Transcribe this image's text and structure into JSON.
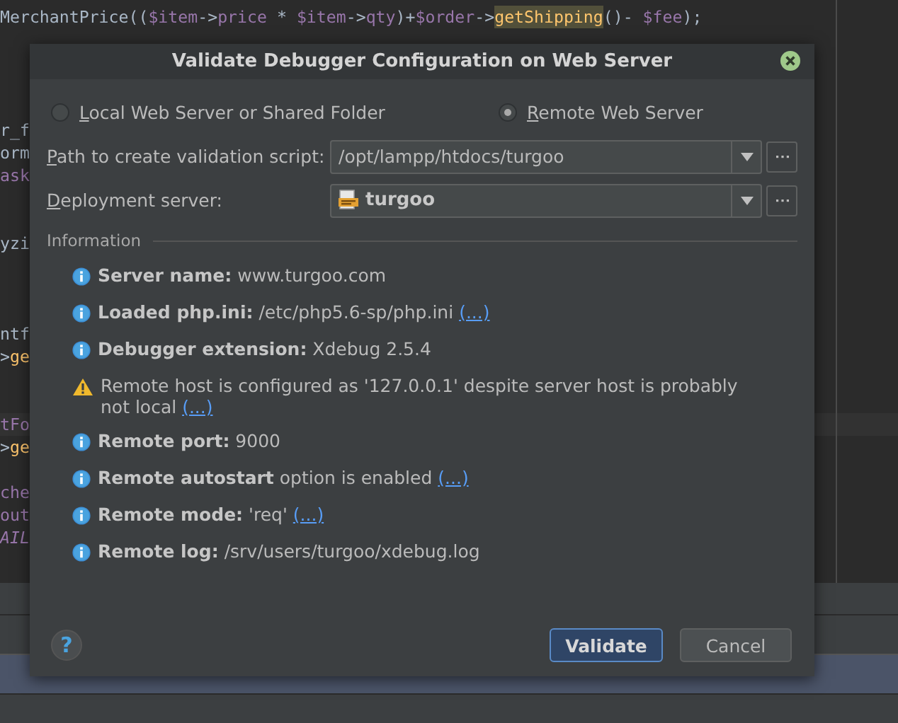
{
  "editor": {
    "lines": [
      {
        "kind": "code",
        "segments": [
          {
            "kind": "plain",
            "text": "MerchantPrice(("
          },
          {
            "kind": "var",
            "text": "$item"
          },
          {
            "kind": "plain",
            "text": "->"
          },
          {
            "kind": "field",
            "text": "price"
          },
          {
            "kind": "plain",
            "text": " * "
          },
          {
            "kind": "var",
            "text": "$item"
          },
          {
            "kind": "plain",
            "text": "->"
          },
          {
            "kind": "field",
            "text": "qty"
          },
          {
            "kind": "plain",
            "text": ")+"
          },
          {
            "kind": "var",
            "text": "$order"
          },
          {
            "kind": "plain",
            "text": "->"
          },
          {
            "kind": "usage",
            "text": "getShipping"
          },
          {
            "kind": "plain",
            "text": "()- "
          },
          {
            "kind": "var",
            "text": "$fee"
          },
          {
            "kind": "plain",
            "text": ");"
          }
        ]
      },
      {
        "kind": "blank"
      },
      {
        "kind": "blank"
      },
      {
        "kind": "blank"
      },
      {
        "kind": "blank"
      },
      {
        "kind": "code",
        "segments": [
          {
            "kind": "plain",
            "text": "r_f"
          }
        ]
      },
      {
        "kind": "code",
        "segments": [
          {
            "kind": "plain",
            "text": "orm"
          }
        ]
      },
      {
        "kind": "code",
        "segments": [
          {
            "kind": "field",
            "text": "ask"
          }
        ]
      },
      {
        "kind": "blank"
      },
      {
        "kind": "blank"
      },
      {
        "kind": "code",
        "segments": [
          {
            "kind": "plain",
            "text": "yzi"
          }
        ]
      },
      {
        "kind": "blank"
      },
      {
        "kind": "blank"
      },
      {
        "kind": "blank"
      },
      {
        "kind": "code",
        "segments": [
          {
            "kind": "plain",
            "text": "ntf"
          }
        ]
      },
      {
        "kind": "code",
        "segments": [
          {
            "kind": "plain",
            "text": ">"
          },
          {
            "kind": "method",
            "text": "ge"
          }
        ]
      },
      {
        "kind": "blank"
      },
      {
        "kind": "blank"
      },
      {
        "kind": "code",
        "current": true,
        "segments": [
          {
            "kind": "field",
            "text": "tFo"
          }
        ]
      },
      {
        "kind": "code",
        "segments": [
          {
            "kind": "plain",
            "text": ">"
          },
          {
            "kind": "method",
            "text": "ge"
          }
        ]
      },
      {
        "kind": "blank"
      },
      {
        "kind": "code",
        "segments": [
          {
            "kind": "field",
            "text": "che"
          }
        ]
      },
      {
        "kind": "code",
        "segments": [
          {
            "kind": "field",
            "text": "out"
          }
        ]
      },
      {
        "kind": "code",
        "segments": [
          {
            "kind": "const",
            "text": "AIL"
          }
        ]
      }
    ]
  },
  "dialog": {
    "title": "Validate Debugger Configuration on Web Server",
    "modes": [
      {
        "label": "Local Web Server or Shared Folder",
        "selected": false
      },
      {
        "label": "Remote Web Server",
        "selected": true
      }
    ],
    "fields": [
      {
        "kind": "path",
        "label": "Path to create validation script:",
        "value": "/opt/lampp/htdocs/turgoo"
      },
      {
        "kind": "server",
        "label": "Deployment server:",
        "value": "turgoo"
      }
    ],
    "information": {
      "title": "Information",
      "items": [
        {
          "kind": "info",
          "text": "**Server name:** www.turgoo.com"
        },
        {
          "kind": "info",
          "text": "**Loaded php.ini:** /etc/php5.6-sp/php.ini",
          "link": "(...)"
        },
        {
          "kind": "info",
          "text": "**Debugger extension:** Xdebug 2.5.4"
        },
        {
          "kind": "warning",
          "text": "Remote host is configured as '127.0.0.1' despite server host is probably not local",
          "link": "(...)"
        },
        {
          "kind": "info",
          "text": "**Remote port:** 9000"
        },
        {
          "kind": "info",
          "text": "**Remote autostart** option is enabled",
          "link": "(...)"
        },
        {
          "kind": "info",
          "text": "**Remote mode:** 'req'",
          "link": "(...)"
        },
        {
          "kind": "info",
          "text": "**Remote log:** /srv/users/turgoo/xdebug.log"
        }
      ]
    },
    "help": "?",
    "buttons": [
      {
        "label": "Validate",
        "kind": "default"
      },
      {
        "label": "Cancel",
        "kind": "normal"
      }
    ]
  }
}
